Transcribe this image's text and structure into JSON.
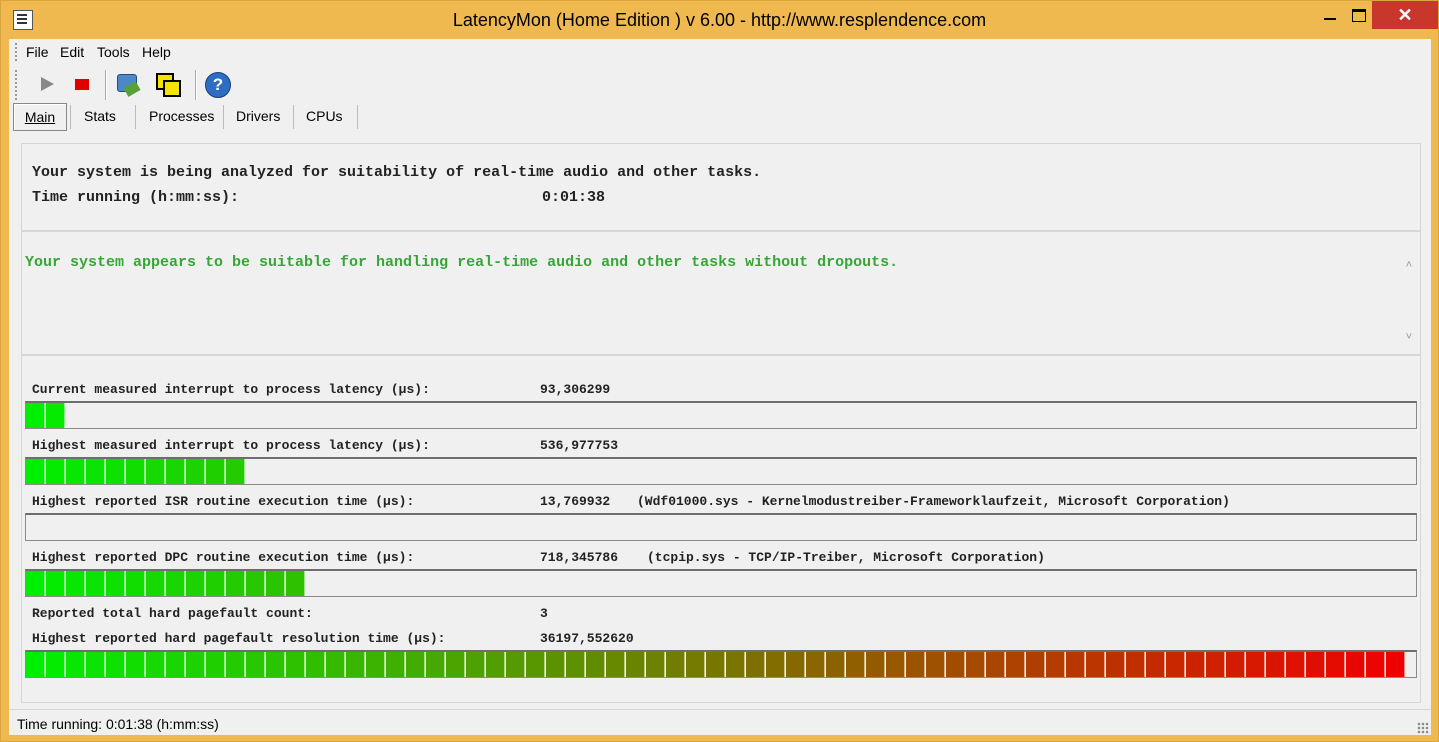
{
  "window": {
    "title": "LatencyMon  (Home Edition )  v 6.00 - http://www.resplendence.com",
    "close_glyph": "✕"
  },
  "menu": {
    "items": [
      "File",
      "Edit",
      "Tools",
      "Help"
    ]
  },
  "toolbar": {
    "buttons": [
      {
        "icon": "play-icon"
      },
      {
        "icon": "stop-icon"
      },
      {
        "icon": "drivers-icon"
      },
      {
        "icon": "windows-icon"
      },
      {
        "icon": "help-icon",
        "glyph": "?"
      }
    ]
  },
  "tabs": [
    "Main",
    "Stats",
    "Processes",
    "Drivers",
    "CPUs"
  ],
  "header_panel": {
    "analyzing_text": "Your system is being analyzed for suitability of real-time audio and other tasks.",
    "time_label": "Time running (h:mm:ss):",
    "time_value": "0:01:38"
  },
  "result_panel": {
    "message": "Your system appears to be suitable for handling real-time audio and other tasks without dropouts.",
    "message_color": "#37a637",
    "scroll_up": "˄",
    "scroll_down": "˅"
  },
  "metrics": {
    "current_latency": {
      "label": "Current measured interrupt to process latency (µs):",
      "value": "93,306299",
      "bar_fraction": 0.026
    },
    "highest_latency": {
      "label": "Highest measured interrupt to process latency (µs):",
      "value": "536,977753",
      "bar_fraction": 0.157
    },
    "highest_isr": {
      "label": "Highest reported ISR routine execution time (µs):",
      "value": "13,769932",
      "extra": "(Wdf01000.sys - Kernelmodustreiber-Frameworklaufzeit, Microsoft Corporation)",
      "bar_fraction": 0.0
    },
    "highest_dpc": {
      "label": "Highest reported DPC routine execution time (µs):",
      "value": "718,345786",
      "extra": "(tcpip.sys - TCP/IP-Treiber, Microsoft Corporation)",
      "bar_fraction": 0.2
    },
    "pagefault_count": {
      "label": "Reported total hard pagefault count:",
      "value": "3"
    },
    "pagefault_time": {
      "label": "Highest reported hard pagefault resolution time (µs):",
      "value": "36197,552620",
      "bar_fraction": 1.0
    }
  },
  "status": {
    "text": "Time running: 0:01:38  (h:mm:ss)"
  },
  "colors": {
    "title_bar": "#f0b950",
    "close_button": "#c7372c",
    "bar_start": "#00ee00",
    "bar_end": "#ee0000"
  }
}
